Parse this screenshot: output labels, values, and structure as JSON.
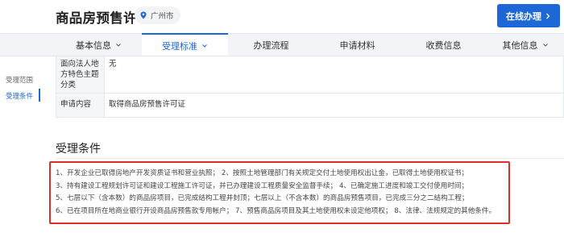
{
  "header": {
    "title": "商品房预售许可",
    "location": "广州市",
    "apply_button": "在线办理"
  },
  "tabs": [
    {
      "label": "基本信息",
      "has_dropdown": true,
      "active": false
    },
    {
      "label": "受理标准",
      "has_dropdown": true,
      "active": true
    },
    {
      "label": "办理流程",
      "has_dropdown": false,
      "active": false
    },
    {
      "label": "申请材料",
      "has_dropdown": false,
      "active": false
    },
    {
      "label": "收费信息",
      "has_dropdown": false,
      "active": false
    },
    {
      "label": "其他信息",
      "has_dropdown": true,
      "active": false
    }
  ],
  "side_nav": {
    "items": [
      {
        "label": "受理范围",
        "active": false
      },
      {
        "label": "受理条件",
        "active": true
      }
    ]
  },
  "info_table": {
    "rows": [
      {
        "key": "面向法人地方特色主题分类",
        "value": "无"
      },
      {
        "key": "申请内容",
        "value": "取得商品房预售许可证"
      }
    ]
  },
  "conditions": {
    "title": "受理条件",
    "lines": [
      "1、开发企业已取得房地产开发资质证书和营业执照；  2、按照土地管理部门有关规定交付土地使用权出让金，已取得土地使用权证书；",
      "3、持有建设工程规划许可证和建设工程施工许可证，并已办理建设工程质量安全监督手续；  4、已确定施工进度和竣工交付使用时间；",
      "5、七层以下（含本数）的商品房项目，已完成结构工程并封顶；七层以上（不含本数）的商品房预售项目，已完成三分之二结构工程；",
      "6、已在项目所在地商业银行开设商品房预售款专用帐户；  7、预售商品房项目及其土地使用权未设定他项权；  8、法律、法规规定的其他条件。"
    ]
  },
  "colors": {
    "accent": "#1d68d6",
    "highlight_border": "#d9302c"
  }
}
